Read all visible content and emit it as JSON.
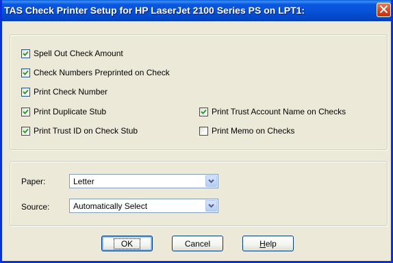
{
  "window": {
    "title": "TAS Check Printer Setup for HP LaserJet 2100 Series PS on LPT1:"
  },
  "options": {
    "spell_out": {
      "label": "Spell Out Check Amount",
      "checked": true
    },
    "preprinted": {
      "label": "Check Numbers Preprinted on Check",
      "checked": true
    },
    "print_number": {
      "label": "Print Check Number",
      "checked": true
    },
    "duplicate_stub": {
      "label": "Print Duplicate Stub",
      "checked": true
    },
    "trust_id": {
      "label": "Print Trust ID on Check Stub",
      "checked": true
    },
    "trust_account_name": {
      "label": "Print Trust Account Name on Checks",
      "checked": true
    },
    "memo": {
      "label": "Print Memo on Checks",
      "checked": false
    }
  },
  "paper": {
    "label": "Paper:",
    "value": "Letter"
  },
  "source": {
    "label": "Source:",
    "value": "Automatically Select"
  },
  "buttons": {
    "ok": "OK",
    "cancel": "Cancel",
    "help_first": "H",
    "help_rest": "elp"
  },
  "colors": {
    "titlebar": "#0553d8",
    "dialog_bg": "#ece9d8",
    "check_mark": "#21a121",
    "close_button": "#d8431d"
  },
  "icons": {
    "close": "close-x-icon",
    "check": "check-mark-icon",
    "dropdown": "chevron-down-icon"
  }
}
